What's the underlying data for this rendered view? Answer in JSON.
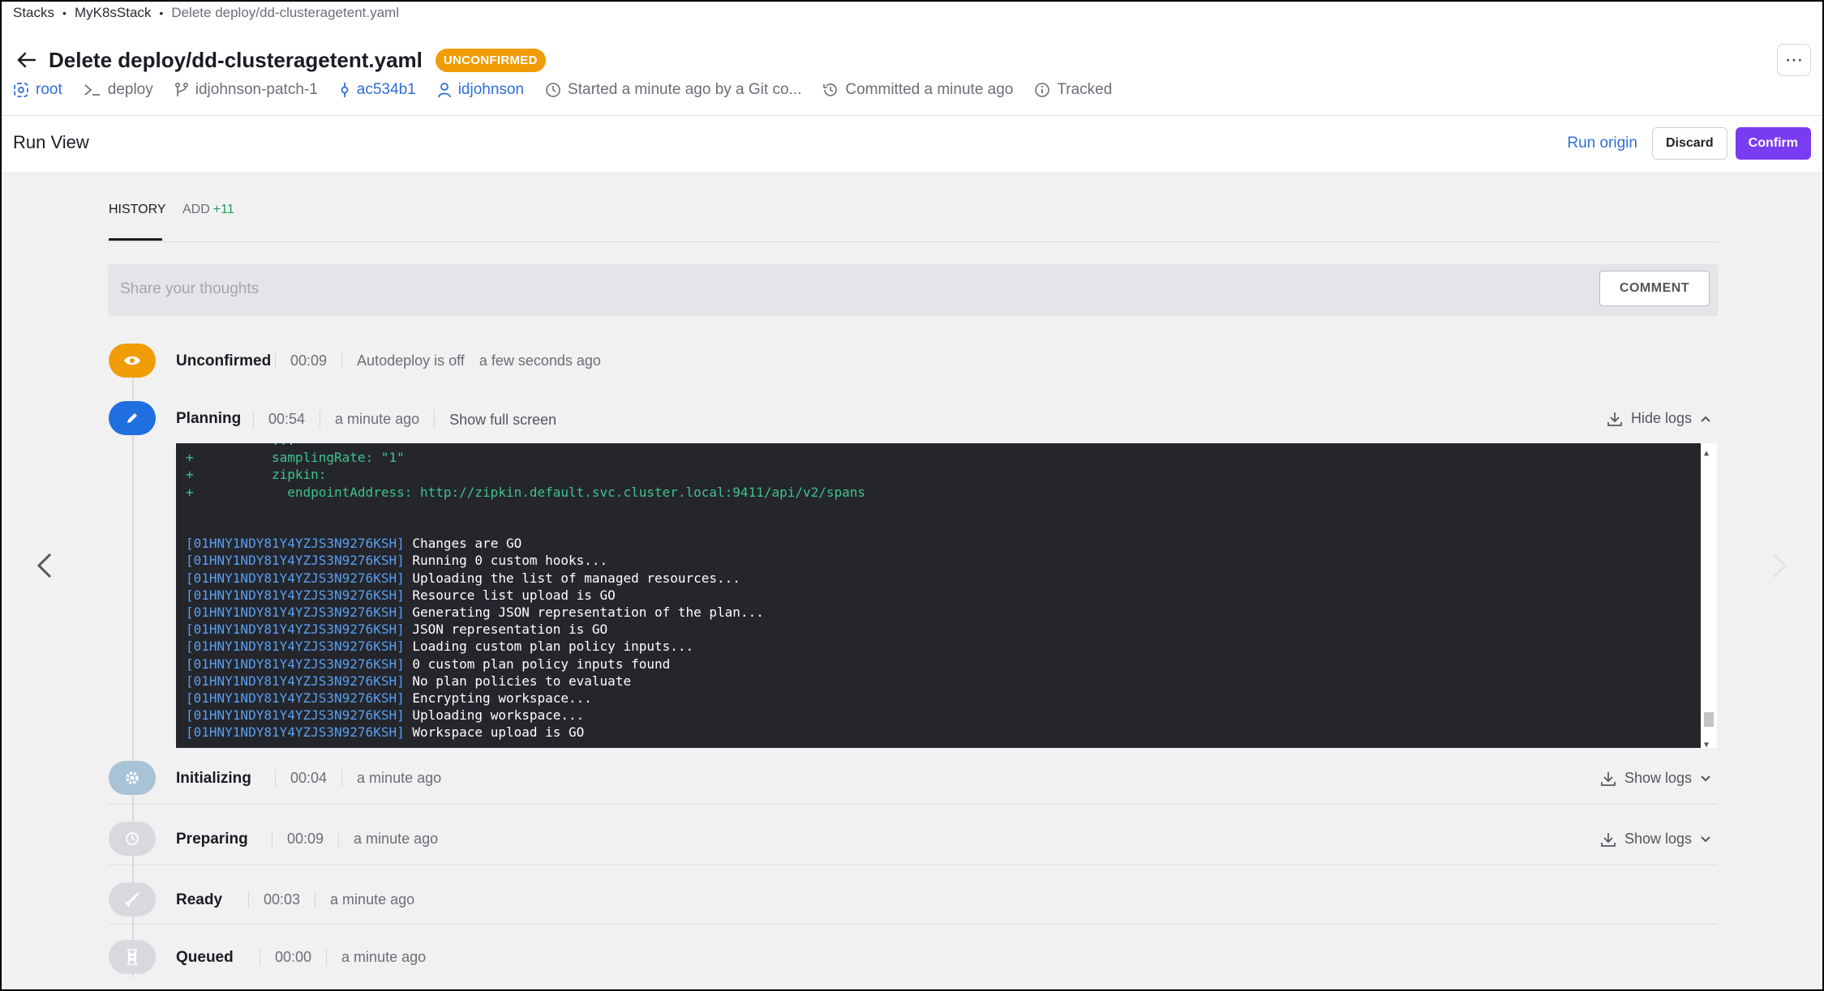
{
  "breadcrumb": [
    "Stacks",
    "MyK8sStack",
    "Delete deploy/dd-clusteragetent.yaml"
  ],
  "header": {
    "title": "Delete deploy/dd-clusteragetent.yaml",
    "badge": "UNCONFIRMED",
    "more": "⋯"
  },
  "meta": {
    "space": "root",
    "project": "deploy",
    "branch": "idjohnson-patch-1",
    "commit": "ac534b1",
    "user": "idjohnson",
    "started": "Started a minute ago by a Git co...",
    "committed": "Committed a minute ago",
    "tracked": "Tracked"
  },
  "runbar": {
    "title": "Run View",
    "run_origin": "Run origin",
    "discard": "Discard",
    "confirm": "Confirm"
  },
  "tabs": {
    "history": "HISTORY",
    "add": "ADD",
    "add_count": "+11"
  },
  "comment": {
    "placeholder": "Share your thoughts",
    "button": "COMMENT"
  },
  "rows": {
    "unconfirmed": {
      "state": "Unconfirmed",
      "duration": "00:09",
      "note": "Autodeploy is off",
      "time": "a few seconds ago"
    },
    "planning": {
      "state": "Planning",
      "duration": "00:54",
      "time": "a minute ago",
      "fullscreen": "Show full screen",
      "logs": "Hide logs"
    },
    "initializing": {
      "state": "Initializing",
      "duration": "00:04",
      "time": "a minute ago",
      "logs": "Show logs"
    },
    "preparing": {
      "state": "Preparing",
      "duration": "00:09",
      "time": "a minute ago",
      "logs": "Show logs"
    },
    "ready": {
      "state": "Ready",
      "duration": "00:03",
      "time": "a minute ago"
    },
    "queued": {
      "state": "Queued",
      "duration": "00:00",
      "time": "a minute ago"
    }
  },
  "logs": {
    "diff": [
      "+          samplingRate: \"1\"",
      "+          zipkin:",
      "+            endpointAddress: http://zipkin.default.svc.cluster.local:9411/api/v2/spans"
    ],
    "run_id": "[01HNY1NDY81Y4YZJS3N9276KSH]",
    "messages": [
      "Changes are GO",
      "Running 0 custom hooks...",
      "Uploading the list of managed resources...",
      "Resource list upload is GO",
      "Generating JSON representation of the plan...",
      "JSON representation is GO",
      "Loading custom plan policy inputs...",
      "0 custom plan policy inputs found",
      "No plan policies to evaluate",
      "Encrypting workspace...",
      "Uploading workspace...",
      "Workspace upload is GO"
    ]
  },
  "colors": {
    "accent": "#7a3cf2",
    "link": "#2f6fd8",
    "unconfirmed": "#f09c06",
    "planning": "#1f6fe0",
    "done": "#a8c2d6"
  }
}
